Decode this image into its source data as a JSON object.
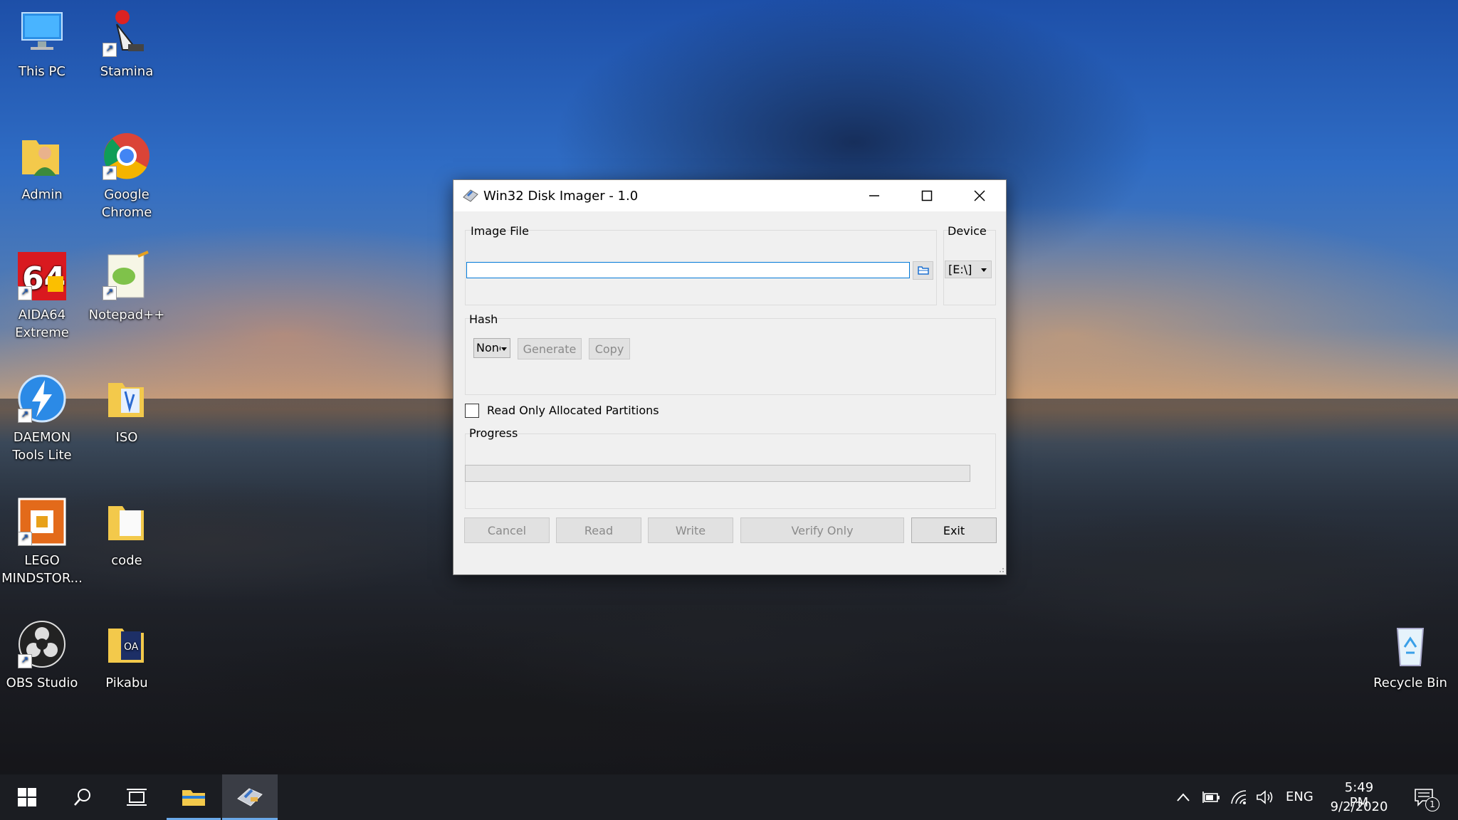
{
  "desktop_icons": [
    {
      "label": "This PC"
    },
    {
      "label": "Stamina"
    },
    {
      "label": "Admin"
    },
    {
      "label": "Google Chrome"
    },
    {
      "label": "AIDA64 Extreme"
    },
    {
      "label": "Notepad++"
    },
    {
      "label": "DAEMON Tools Lite"
    },
    {
      "label": "ISO"
    },
    {
      "label": "LEGO MINDSTOR..."
    },
    {
      "label": "code"
    },
    {
      "label": "OBS Studio"
    },
    {
      "label": "Pikabu"
    },
    {
      "label": "Recycle Bin"
    }
  ],
  "window": {
    "title": "Win32 Disk Imager - 1.0",
    "image_file_label": "Image File",
    "image_file_value": "",
    "device_label": "Device",
    "device_value": "[E:\\]",
    "hash_label": "Hash",
    "hash_value": "None",
    "generate_label": "Generate",
    "copy_label": "Copy",
    "read_only_label": "Read Only Allocated Partitions",
    "read_only_checked": false,
    "progress_label": "Progress",
    "progress_value": 0,
    "buttons": {
      "cancel": "Cancel",
      "read": "Read",
      "write": "Write",
      "verify": "Verify Only",
      "exit": "Exit"
    }
  },
  "taskbar": {
    "language": "ENG",
    "time": "5:49 PM",
    "date": "9/2/2020",
    "notification_count": "1"
  },
  "colors": {
    "accent": "#0078d7",
    "taskbar": "#1b1d22",
    "window_bg": "#f0f0f0"
  }
}
